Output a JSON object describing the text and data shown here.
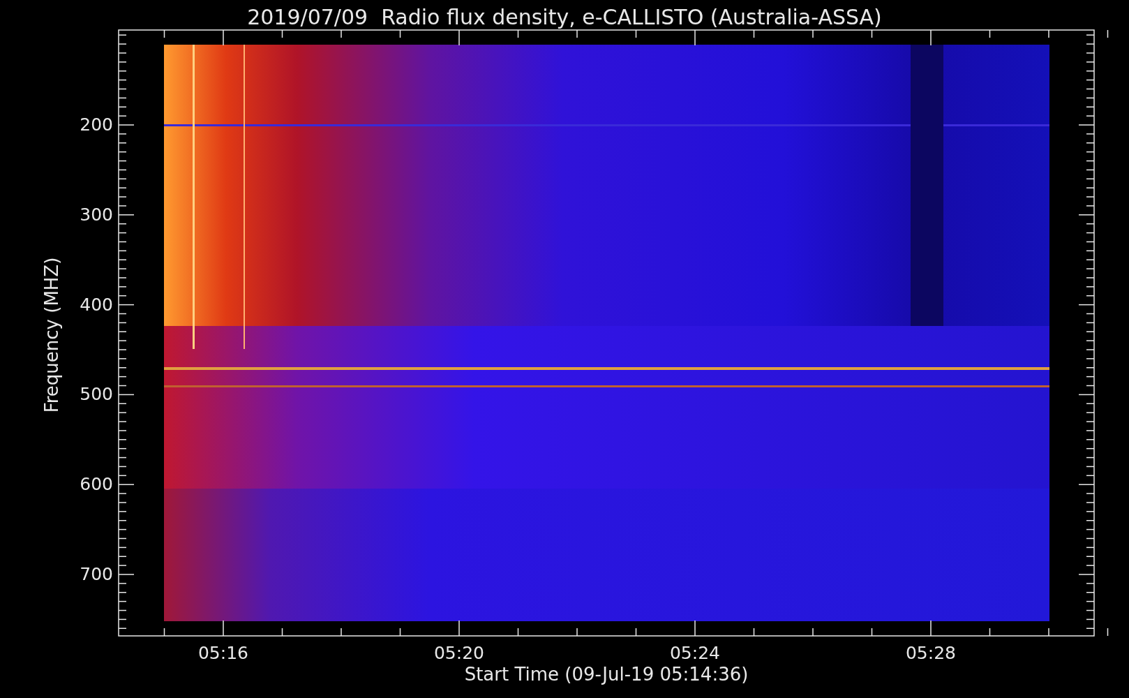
{
  "plot": {
    "title": "2019/07/09  Radio flux density, e-CALLISTO (Australia-ASSA)",
    "ylabel": "Frequency (MHZ)",
    "xlabel": "Start Time (09-Jul-19 05:14:36)",
    "yticks": [
      "200",
      "300",
      "400",
      "500",
      "600",
      "700"
    ],
    "xticks": [
      "05:16",
      "05:20",
      "05:24",
      "05:28"
    ]
  }
}
